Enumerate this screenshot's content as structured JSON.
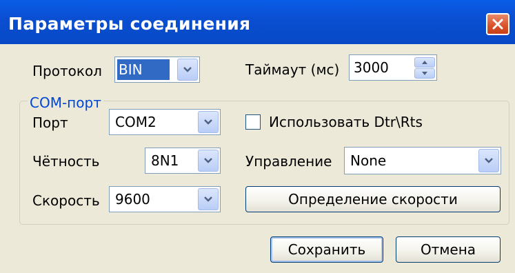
{
  "window": {
    "title": "Параметры соединения"
  },
  "protocol": {
    "label": "Протокол",
    "value": "BIN"
  },
  "timeout": {
    "label": "Таймаут (мс)",
    "value": "3000"
  },
  "com_group": {
    "title": "COM-порт",
    "port": {
      "label": "Порт",
      "value": "COM2"
    },
    "use_dtr_rts": {
      "label": "Использовать Dtr\\Rts",
      "checked": false
    },
    "parity": {
      "label": "Чётность",
      "value": "8N1"
    },
    "control": {
      "label": "Управление",
      "value": "None"
    },
    "speed": {
      "label": "Скорость",
      "value": "9600"
    },
    "detect_speed_button": "Определение скорости"
  },
  "buttons": {
    "save": "Сохранить",
    "cancel": "Отмена"
  },
  "icons": {
    "close": "close-icon",
    "dropdown": "chevron-down-icon",
    "spinner": "spin-arrows-icon"
  },
  "colors": {
    "titlebar": "#0a5de8",
    "close_button": "#d8522a",
    "dialog_bg": "#ece9d8",
    "group_title": "#0046d5",
    "selection": "#316ac5"
  }
}
